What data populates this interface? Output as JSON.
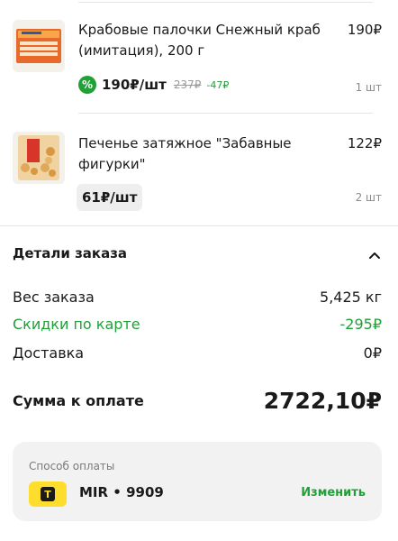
{
  "items": [
    {
      "name": "Крабовые палочки Снежный краб (имитация), 200 г",
      "price": "190₽",
      "unit_price": "190₽/шт",
      "old_price": "237₽",
      "discount": "-47₽",
      "discount_badge_icon": "percent-icon",
      "qty": "1 шт"
    },
    {
      "name": "Печенье затяжное \"Забавные фигурки\"",
      "price": "122₽",
      "unit_price": "61₽/шт",
      "qty": "2 шт"
    }
  ],
  "details": {
    "title": "Детали заказа",
    "rows": [
      {
        "label": "Вес заказа",
        "value": "5,425 кг"
      },
      {
        "label": "Скидки по карте",
        "value": "-295₽"
      },
      {
        "label": "Доставка",
        "value": "0₽"
      }
    ],
    "total_label": "Сумма к оплате",
    "total_value": "2722,10₽"
  },
  "payment": {
    "label": "Способ оплаты",
    "card": "MIR • 9909",
    "change": "Изменить",
    "bank_icon": "bank-logo-icon"
  },
  "colors": {
    "accent_green": "#21a038",
    "bank_yellow": "#ffdd2d"
  }
}
